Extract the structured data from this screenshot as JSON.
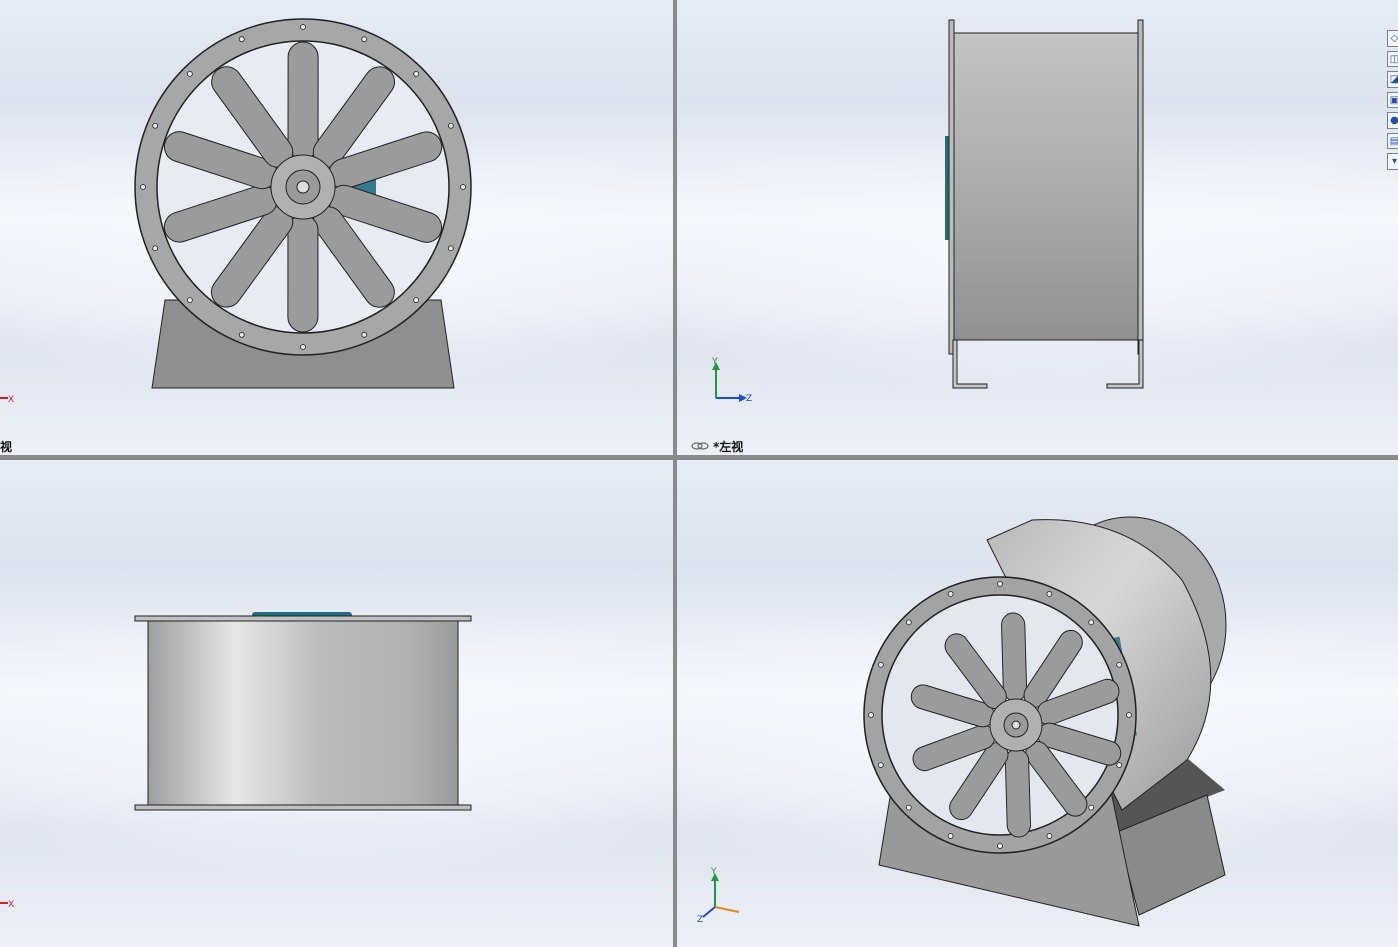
{
  "viewports": {
    "top_left": {
      "label": "视",
      "triad": [
        "X"
      ]
    },
    "top_right": {
      "label": "*左视",
      "triad": [
        "Y",
        "Z"
      ]
    },
    "bottom_left": {
      "label": "",
      "triad": [
        "X"
      ]
    },
    "bottom_right": {
      "label": "",
      "triad": [
        "Y",
        "Z"
      ]
    }
  },
  "colors": {
    "metal": "#9a9a9a",
    "motor": "#1f6f80",
    "edge": "#222222",
    "axis_y": "#1f9a3a",
    "axis_x": "#d02020",
    "axis_z": "#1a4fcf"
  },
  "toolbar_icons": [
    "view-orientation-icon",
    "section-view-icon",
    "display-style-icon",
    "hide-show-icon",
    "appearance-icon",
    "scene-icon",
    "view-settings-icon"
  ]
}
